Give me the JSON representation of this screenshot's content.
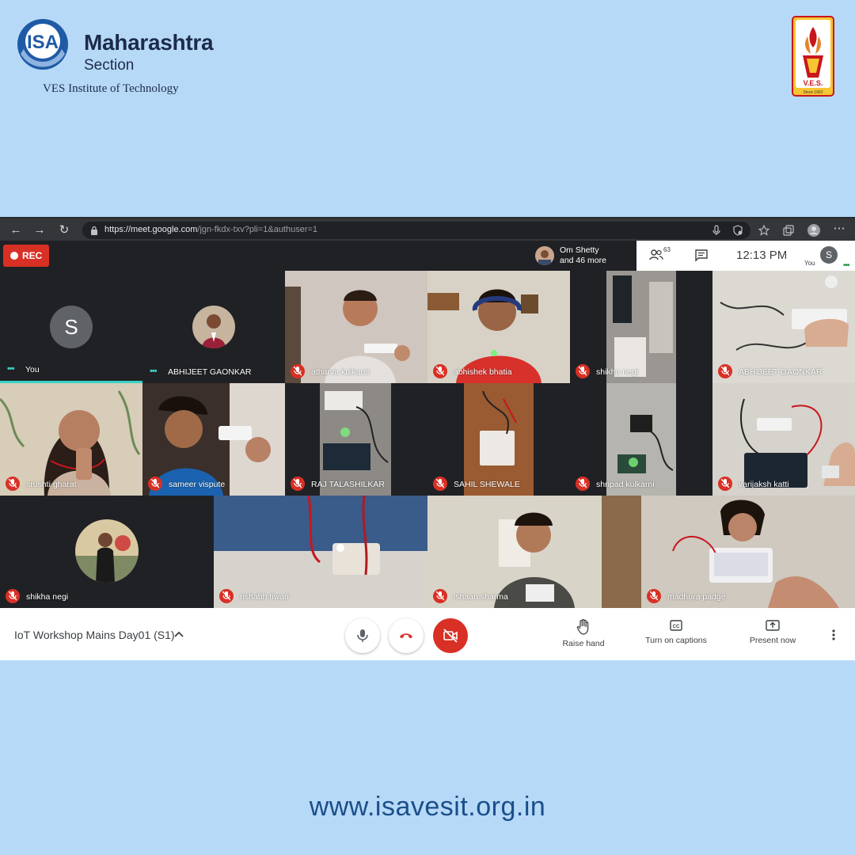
{
  "branding": {
    "isa_mark": "ISA",
    "title": "Maharashtra",
    "subtitle": "Section",
    "institute": "VES Institute of Technology",
    "ves_mark": "V.E.S.",
    "ves_since": "Since 1962"
  },
  "browser": {
    "url_host": "https://meet.google.com",
    "url_path": "/jgn-fkdx-txv?pli=1&authuser=1",
    "icons": [
      "back-icon",
      "forward-icon",
      "reload-icon",
      "lock-icon",
      "mic-icon",
      "tracking-icon",
      "favorites-icon",
      "collections-icon",
      "profile-icon",
      "more-icon"
    ]
  },
  "meet_top": {
    "rec_label": "REC",
    "presenter_name": "Om Shetty",
    "presenter_more": "and 46 more",
    "people_count": "63",
    "time": "12:13  PM",
    "self_initial": "S",
    "self_label": "You"
  },
  "tiles": [
    {
      "name": "You",
      "muted": false,
      "kind": "letter",
      "letter": "S"
    },
    {
      "name": "ABHIJEET GAONKAR",
      "muted": false,
      "kind": "photo"
    },
    {
      "name": "atharva kulkarni",
      "muted": true,
      "kind": "video"
    },
    {
      "name": "abhishek bhatia",
      "muted": true,
      "kind": "video"
    },
    {
      "name": "shikha negi",
      "muted": true,
      "kind": "video"
    },
    {
      "name": "ABHIJEET GAONKAR",
      "muted": true,
      "kind": "video"
    },
    {
      "name": "srushti gharat",
      "muted": true,
      "kind": "video"
    },
    {
      "name": "sameer vispute",
      "muted": true,
      "kind": "video"
    },
    {
      "name": "RAJ TALASHILKAR",
      "muted": true,
      "kind": "video"
    },
    {
      "name": "SAHIL SHEWALE",
      "muted": true,
      "kind": "video"
    },
    {
      "name": "shripad kulkarni",
      "muted": true,
      "kind": "video"
    },
    {
      "name": "varijaksh katti",
      "muted": true,
      "kind": "video"
    },
    {
      "name": "shikha negi",
      "muted": true,
      "kind": "photo"
    },
    {
      "name": "rishabh tiwari",
      "muted": true,
      "kind": "video"
    },
    {
      "name": "ishaan sharma",
      "muted": true,
      "kind": "video"
    },
    {
      "name": "madhura padge",
      "muted": true,
      "kind": "video"
    }
  ],
  "meet_bottom": {
    "meeting_title": "IoT Workshop Mains Day01 (S1)",
    "raise_hand": "Raise hand",
    "captions": "Turn on captions",
    "present": "Present now"
  },
  "footer": {
    "url": "www.isavesit.org.in"
  },
  "colors": {
    "background": "#b7d9f8",
    "meet_red": "#d93025",
    "meet_dark": "#202124",
    "brand_navy": "#1d2b4a"
  }
}
